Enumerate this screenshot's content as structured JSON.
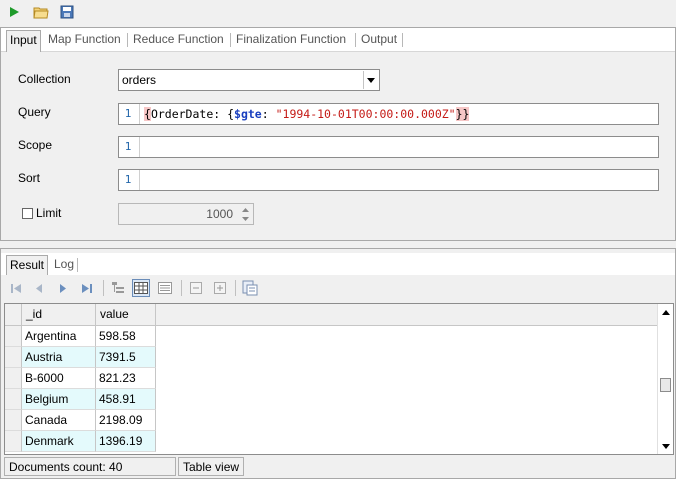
{
  "toolbar": {
    "icons": [
      "run-icon",
      "open-folder-icon",
      "save-icon"
    ]
  },
  "input_tabs": [
    "Input",
    "Map Function",
    "Reduce Function",
    "Finalization Function",
    "Output"
  ],
  "form": {
    "collection_label": "Collection",
    "collection_value": "orders",
    "query_label": "Query",
    "query_line": "1",
    "query_parts": {
      "open_brace": "{",
      "key": "OrderDate",
      "colon": ": {",
      "op": "$gte",
      "colon2": ": ",
      "value": "\"1994-10-01T00:00:00.000Z\"",
      "close": "}}"
    },
    "scope_label": "Scope",
    "scope_line": "1",
    "sort_label": "Sort",
    "sort_line": "1",
    "limit_label": "Limit",
    "limit_checked": false,
    "limit_value": "1000"
  },
  "result_tabs": [
    "Result",
    "Log"
  ],
  "grid": {
    "columns": [
      "_id",
      "value"
    ],
    "rows": [
      {
        "id": "Argentina",
        "value": "598.58"
      },
      {
        "id": "Austria",
        "value": "7391.5"
      },
      {
        "id": "B-6000",
        "value": "821.23"
      },
      {
        "id": "Belgium",
        "value": "458.91"
      },
      {
        "id": "Canada",
        "value": "2198.09"
      },
      {
        "id": "Denmark",
        "value": "1396.19"
      }
    ]
  },
  "status": {
    "documents_count": "Documents count: 40",
    "view_mode": "Table view"
  },
  "colors": {
    "run_green": "#1f9b2b",
    "query_key": "#000000",
    "query_op": "#1a3fbf",
    "query_string": "#c41a16",
    "brace_highlight": "#f6c6c6",
    "alt_row": "#e4fafc"
  }
}
